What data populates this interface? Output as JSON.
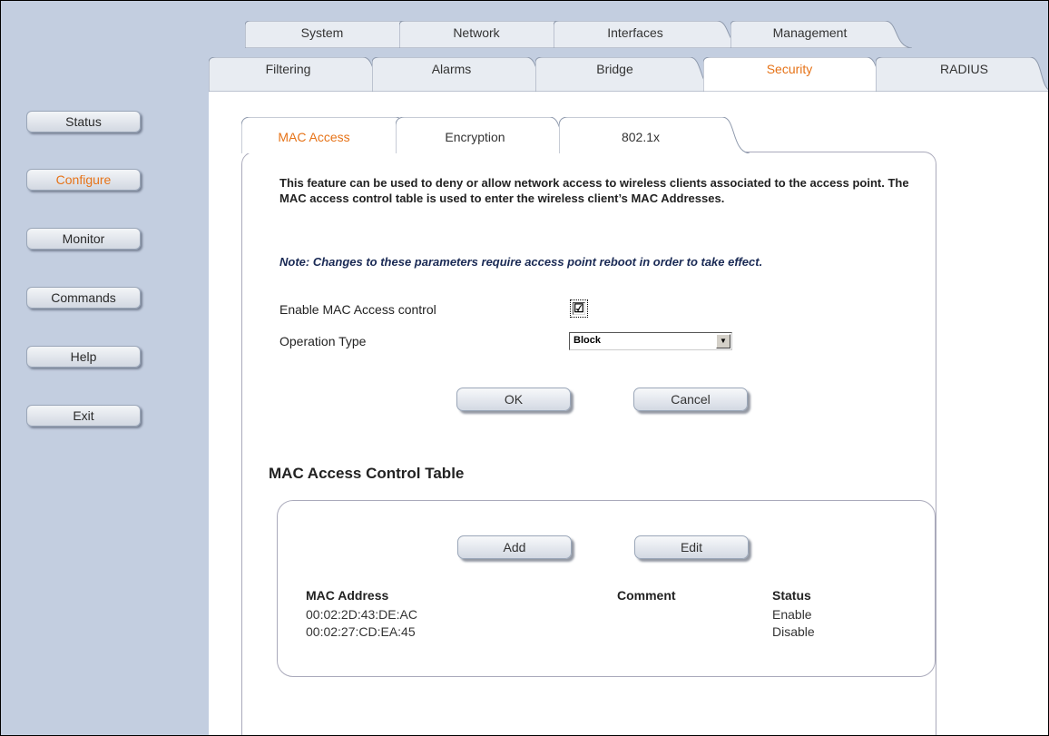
{
  "sidebar": {
    "items": [
      {
        "label": "Status"
      },
      {
        "label": "Configure"
      },
      {
        "label": "Monitor"
      },
      {
        "label": "Commands"
      },
      {
        "label": "Help"
      },
      {
        "label": "Exit"
      }
    ],
    "active": "Configure"
  },
  "top_tabs": [
    {
      "label": "System"
    },
    {
      "label": "Network"
    },
    {
      "label": "Interfaces"
    },
    {
      "label": "Management"
    }
  ],
  "second_tabs": [
    {
      "label": "Filtering"
    },
    {
      "label": "Alarms"
    },
    {
      "label": "Bridge"
    },
    {
      "label": "Security"
    },
    {
      "label": "RADIUS"
    }
  ],
  "second_tabs_selected": "Security",
  "sub_tabs": [
    {
      "label": "MAC Access"
    },
    {
      "label": "Encryption"
    },
    {
      "label": "802.1x"
    }
  ],
  "sub_tabs_selected": "MAC Access",
  "main": {
    "description": "This feature can be used to deny or allow network access to wireless clients associated to the access point. The MAC access control table is used to enter the wireless client’s MAC Addresses.",
    "note": "Note: Changes to these parameters require access point reboot in order to take effect.",
    "enable_label": "Enable MAC Access control",
    "enable_checked": true,
    "check_glyph": "☑",
    "operation_label": "Operation Type",
    "operation_value": "Block",
    "ok_label": "OK",
    "cancel_label": "Cancel"
  },
  "table": {
    "title": "MAC Access Control Table",
    "add_label": "Add",
    "edit_label": "Edit",
    "headers": {
      "mac": "MAC Address",
      "comment": "Comment",
      "status": "Status"
    },
    "rows": [
      {
        "mac": "00:02:2D:43:DE:AC",
        "comment": "",
        "status": "Enable"
      },
      {
        "mac": "00:02:27:CD:EA:45",
        "comment": "",
        "status": "Disable"
      }
    ]
  },
  "colors": {
    "sidebar_bg": "#c3cee0",
    "tab_fill": "#e8ecf2",
    "selected_text": "#e67318",
    "note_text": "#1a2a55"
  }
}
